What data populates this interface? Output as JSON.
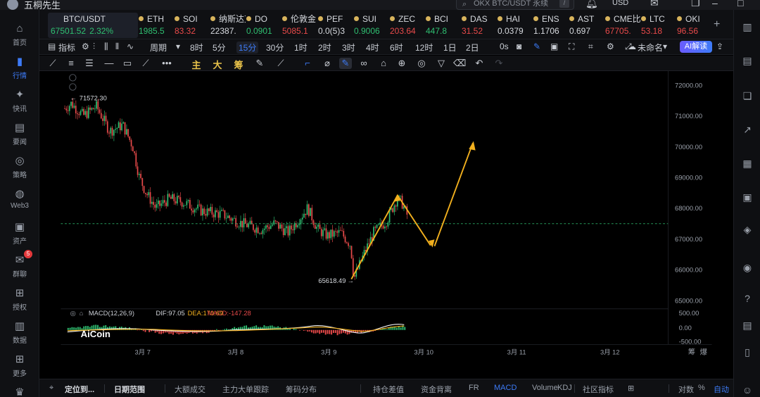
{
  "app": {
    "title": "五桐先生"
  },
  "search": {
    "placeholder": "OKX BTC/USDT 永续",
    "shortcut": "/"
  },
  "currency": "USD",
  "sidebar": [
    {
      "label": "首页",
      "icon": "home-icon"
    },
    {
      "label": "行情",
      "icon": "chart-icon",
      "active": true
    },
    {
      "label": "快讯",
      "icon": "news-icon"
    },
    {
      "label": "要闻",
      "icon": "article-icon"
    },
    {
      "label": "策略",
      "icon": "strategy-icon"
    },
    {
      "label": "Web3",
      "icon": "web3-icon"
    },
    {
      "label": "资产",
      "icon": "wallet-icon"
    },
    {
      "label": "群聊",
      "icon": "chat-icon",
      "badge": "5"
    },
    {
      "label": "授权",
      "icon": "auth-icon"
    },
    {
      "label": "数据",
      "icon": "data-icon"
    },
    {
      "label": "更多",
      "icon": "more-icon"
    },
    {
      "label": "VIP",
      "icon": "vip-icon"
    }
  ],
  "tickers": [
    {
      "name": "BTC/USDT",
      "price": "67501.52",
      "change": "2.32%",
      "dir": "up",
      "selected": true
    },
    {
      "name": "ETH",
      "price": "1985.5",
      "dir": "up"
    },
    {
      "name": "SOI",
      "price": "83.32",
      "dir": "down"
    },
    {
      "name": "纳斯达克",
      "price": "22387.",
      "dir": "neutral"
    },
    {
      "name": "DO",
      "price": "0.0901",
      "dir": "up"
    },
    {
      "name": "伦敦金",
      "price": "5085.1",
      "dir": "down"
    },
    {
      "name": "PEF",
      "price": "0.0(5)3",
      "dir": "neutral"
    },
    {
      "name": "SUI",
      "price": "0.9006",
      "dir": "up"
    },
    {
      "name": "ZEC",
      "price": "203.64",
      "dir": "down"
    },
    {
      "name": "BCI",
      "price": "447.8",
      "dir": "up"
    },
    {
      "name": "DAS",
      "price": "31.52",
      "dir": "down"
    },
    {
      "name": "HAI",
      "price": "0.0379",
      "dir": "neutral"
    },
    {
      "name": "ENS",
      "price": "1.1706",
      "dir": "neutral"
    },
    {
      "name": "AST",
      "price": "0.697",
      "dir": "neutral"
    },
    {
      "name": "CME比特",
      "price": "67705.",
      "dir": "down"
    },
    {
      "name": "LTC",
      "price": "53.18",
      "dir": "down"
    },
    {
      "name": "OKI",
      "price": "96.56",
      "dir": "down"
    }
  ],
  "toolbar": {
    "indicator": "指标",
    "period": "周期",
    "timeframes": [
      "8时",
      "5分",
      "15分",
      "30分",
      "1时",
      "2时",
      "3时",
      "4时",
      "6时",
      "12时",
      "1日",
      "2日"
    ],
    "active_timeframe": "15分",
    "zero_s": "0s",
    "layout_name": "未命名",
    "ai_button": "AI解读"
  },
  "draw_tools": {
    "labels": [
      "主",
      "大",
      "筹"
    ]
  },
  "chart": {
    "high_label": "71572.30",
    "low_label": "65618.49",
    "macd_label": "MACD(12,26,9)",
    "dif": "DIF:97.05",
    "dea": "DEA:170.69",
    "macd_val": "MACD:-147.28",
    "logo": "AiCoin",
    "price_ticks": [
      "72000.00",
      "71000.00",
      "70000.00",
      "69000.00",
      "68000.00",
      "67000.00",
      "66000.00",
      "65000.00"
    ],
    "macd_ticks": [
      "500.00",
      "0.00",
      "-500.00"
    ],
    "date_ticks": [
      "3月 7",
      "3月 8",
      "3月 9",
      "3月 10",
      "3月 11",
      "3月 12"
    ],
    "right_labels": [
      "筹",
      "爆"
    ]
  },
  "bottom": {
    "items": [
      "定位到...",
      "日期范围",
      "大额成交",
      "主力大单跟踪",
      "筹码分布",
      "持仓差值",
      "资金背离",
      "FR",
      "MACD",
      "Volume",
      "KDJ",
      "社区指标",
      "对数",
      "%",
      "自动"
    ]
  }
}
